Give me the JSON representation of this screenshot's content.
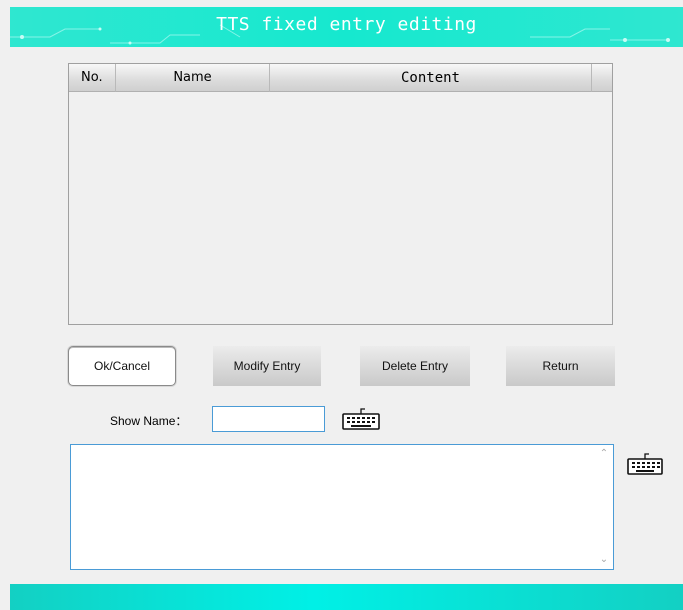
{
  "window": {
    "title": "TTS fixed entry editing"
  },
  "table": {
    "columns": [
      "No.",
      "Name",
      "Content"
    ],
    "rows": []
  },
  "buttons": {
    "ok_cancel": "Ok/Cancel",
    "modify": "Modify Entry",
    "delete": "Delete Entry",
    "return": "Return"
  },
  "form": {
    "show_name_label": "Show Name：",
    "show_name_value": "",
    "content_value": ""
  },
  "icons": {
    "keyboard": "keyboard-icon",
    "scroll_up": "chevron-up-icon",
    "scroll_down": "chevron-down-icon"
  },
  "colors": {
    "titlebar": "#16e8cf",
    "footerbar": "#00f0e6",
    "input_border": "#4a9bd6",
    "background": "#f0f0f0"
  }
}
